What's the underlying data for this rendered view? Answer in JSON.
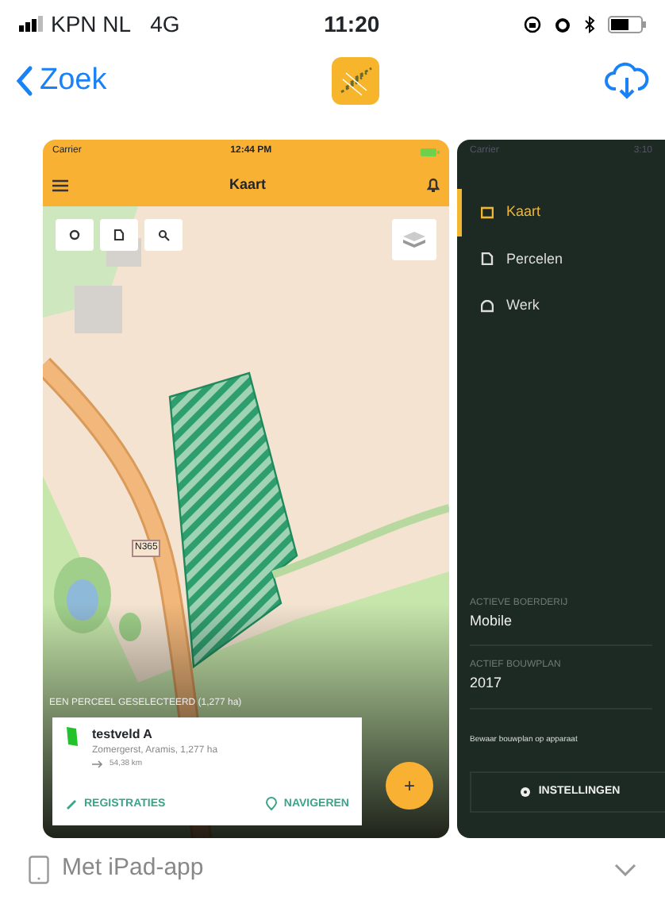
{
  "status_bar": {
    "carrier": "KPN NL",
    "network": "4G",
    "time": "11:20"
  },
  "nav": {
    "back": "Zoek"
  },
  "screenshots": [
    {
      "kind": "map",
      "status": {
        "carrier": "Carrier",
        "time": "12:44 PM"
      },
      "title": "Kaart",
      "road_label": "N365",
      "selection": "EEN PERCEEL GESELECTEERD (1,277 ha)",
      "parcel": {
        "name": "testveld A",
        "details": "Zomergerst, Aramis, 1,277 ha",
        "distance": "54,38 km"
      },
      "actions": [
        "REGISTRATIES",
        "NAVIGEREN"
      ],
      "fab": "+"
    },
    {
      "kind": "menu",
      "status": {
        "carrier": "Carrier",
        "time": "3:10"
      },
      "items": [
        {
          "label": "Kaart",
          "selected": true
        },
        {
          "label": "Percelen",
          "selected": false
        },
        {
          "label": "Werk",
          "selected": false
        }
      ],
      "fields": [
        {
          "label": "ACTIEVE BOERDERIJ",
          "value": "Mobile"
        },
        {
          "label": "ACTIEF BOUWPLAN",
          "value": "2017"
        }
      ],
      "note": "Bewaar bouwplan op apparaat",
      "button": "INSTELLINGEN"
    }
  ],
  "device_row": {
    "label": "Met iPad-app",
    "expanded": false
  }
}
